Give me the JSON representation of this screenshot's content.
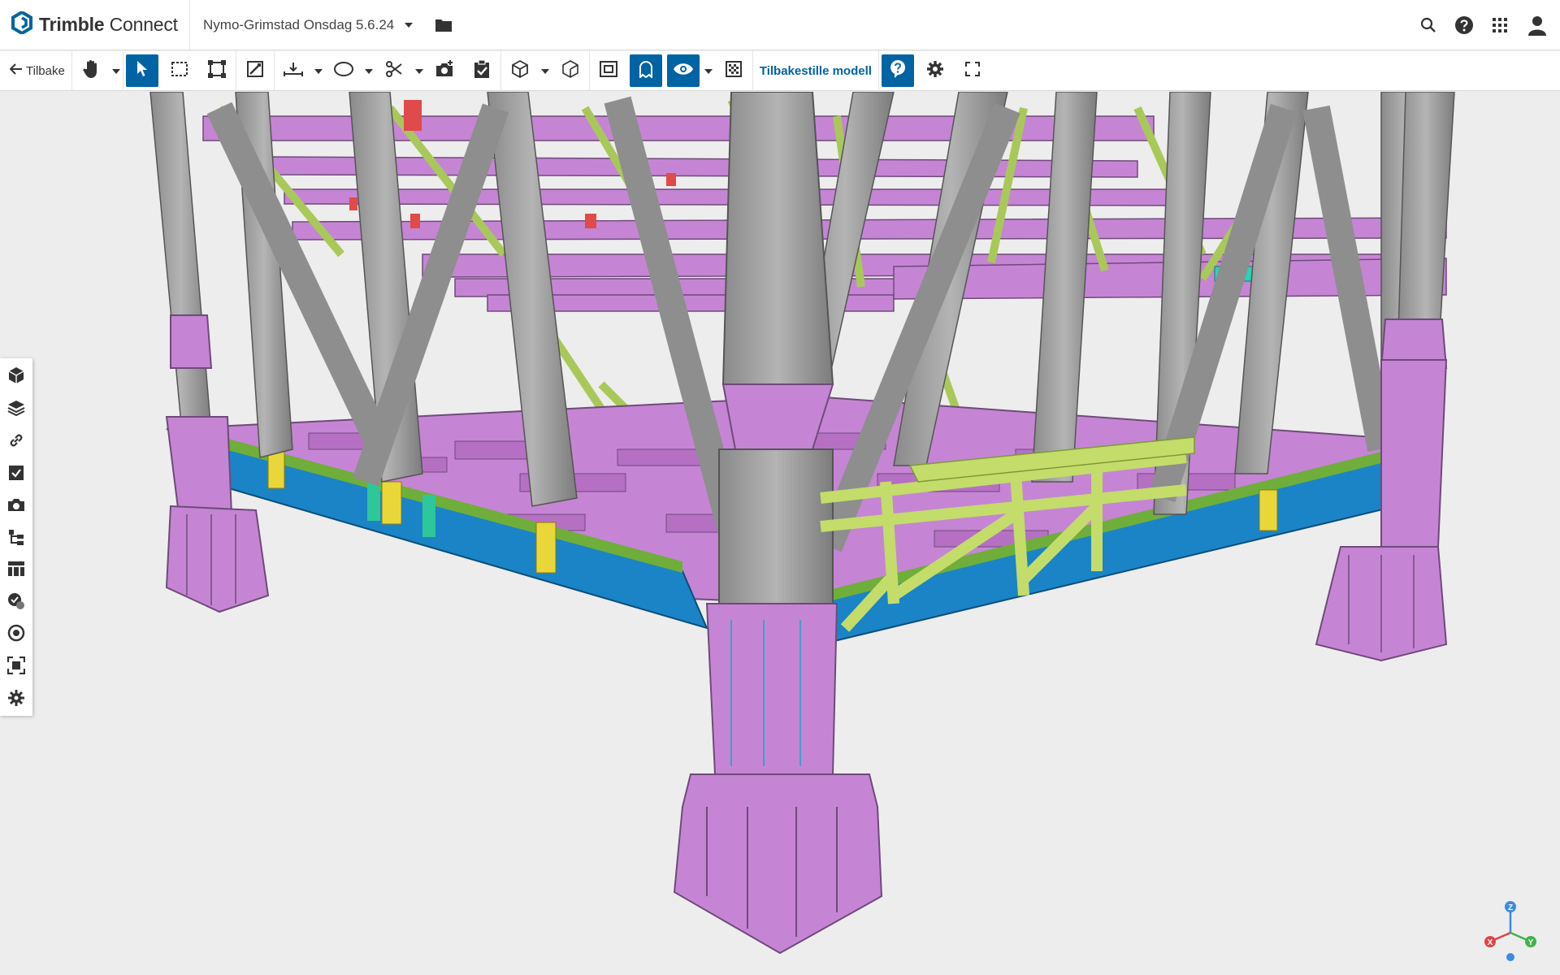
{
  "app": {
    "brand_strong": "Trimble",
    "brand_light": " Connect"
  },
  "project": {
    "name": "Nymo-Grimstad Onsdag 5.6.24"
  },
  "toolbar": {
    "back_label": "Tilbake",
    "reset_model_label": "Tilbakestille modell"
  },
  "axis": {
    "z": "Z",
    "x": "X",
    "y": "Y"
  },
  "colors": {
    "accent": "#0063a3",
    "steel_grey": "#9a9a9a",
    "steel_purple": "#c27fd0",
    "steel_green": "#c3dc6a",
    "steel_blue": "#1f8fd0"
  }
}
